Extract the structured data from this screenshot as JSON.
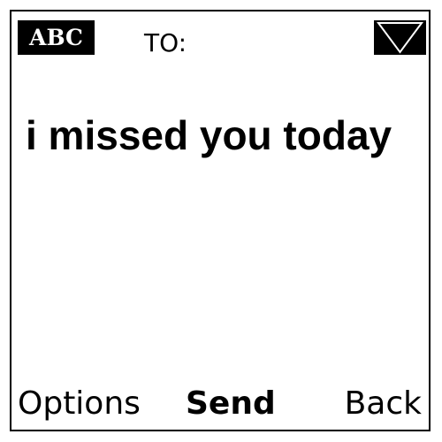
{
  "header": {
    "input_mode": "ABC",
    "to_label": "TO:",
    "dropdown_icon": "dropdown-triangle-icon"
  },
  "message": {
    "text": "i missed you today"
  },
  "softkeys": {
    "left": "Options",
    "center": "Send",
    "right": "Back"
  }
}
